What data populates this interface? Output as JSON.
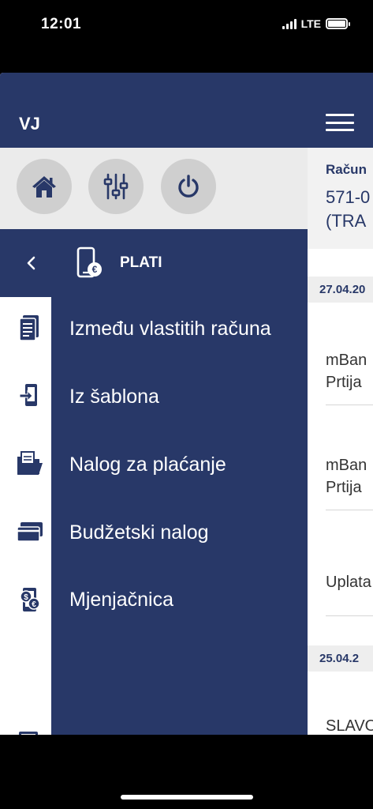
{
  "status_bar": {
    "time": "12:01",
    "network": "LTE"
  },
  "header": {
    "initials": "VJ",
    "menu_icon": "hamburger-icon"
  },
  "toolbar": {
    "buttons": [
      {
        "icon": "home-icon"
      },
      {
        "icon": "sliders-icon"
      },
      {
        "icon": "power-icon"
      }
    ]
  },
  "account": {
    "label": "Račun",
    "number_line1": "571-0",
    "number_line2": "(TRA"
  },
  "dates": [
    "27.04.20",
    "25.04.2"
  ],
  "transactions": [
    {
      "line1": "mBan",
      "line2": "Prtija"
    },
    {
      "line1": "mBan",
      "line2": "Prtija"
    },
    {
      "line1": "Uplata",
      "line2": ""
    },
    {
      "line1": "SLAVO",
      "line2": ""
    }
  ],
  "menu": {
    "title": "PLATI",
    "back_icon": "chevron-left-icon",
    "items": [
      {
        "label": "Između vlastitih računa",
        "icon": "document-icon"
      },
      {
        "label": "Iz šablona",
        "icon": "phone-transfer-icon"
      },
      {
        "label": "Nalog za plaćanje",
        "icon": "folder-payment-icon"
      },
      {
        "label": "Budžetski nalog",
        "icon": "cards-icon"
      },
      {
        "label": "Mjenjačnica",
        "icon": "currency-exchange-icon"
      },
      {
        "label": "",
        "icon": "calculator-icon"
      }
    ]
  },
  "colors": {
    "brand_navy": "#283868",
    "toolbar_bg": "#ebebeb",
    "button_bg": "#cfcfcf"
  }
}
